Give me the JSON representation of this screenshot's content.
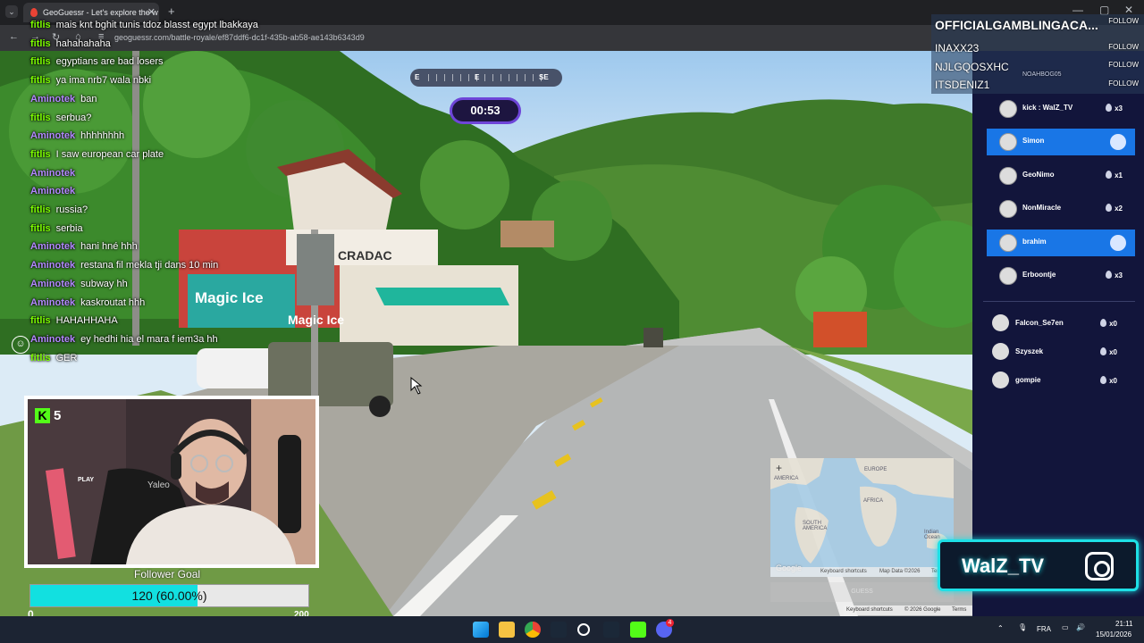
{
  "browser": {
    "tab_title": "GeoGuessr - Let's explore the w",
    "url": "geoguessr.com/battle-royale/ef87ddf6-dc1f-435b-ab58-ae143b6343d9",
    "new_tab": "+",
    "close_tab": "✕"
  },
  "chat": {
    "messages": [
      {
        "user": "fitlis",
        "text": "mais knt bghit tunis tdoz blasst egypt lbakkaya",
        "color": "#7CFC00"
      },
      {
        "user": "fitlis",
        "text": "hahahahaha",
        "color": "#7CFC00"
      },
      {
        "user": "fitlis",
        "text": "egyptians are bad losers",
        "color": "#7CFC00"
      },
      {
        "user": "fitlis",
        "text": "ya ima nrb7 wala nbki",
        "color": "#7CFC00"
      },
      {
        "user": "Aminotek",
        "text": "ban",
        "color": "#b388ff"
      },
      {
        "user": "fitlis",
        "text": "serbua?",
        "color": "#7CFC00"
      },
      {
        "user": "Aminotek",
        "text": "hhhhhhhh",
        "color": "#b388ff"
      },
      {
        "user": "fitlis",
        "text": "I saw european car plate",
        "color": "#7CFC00"
      },
      {
        "user": "Aminotek",
        "text": "",
        "color": "#b388ff"
      },
      {
        "user": "Aminotek",
        "text": "",
        "color": "#b388ff"
      },
      {
        "user": "fitlis",
        "text": "russia?",
        "color": "#7CFC00"
      },
      {
        "user": "fitlis",
        "text": "serbia",
        "color": "#7CFC00"
      },
      {
        "user": "Aminotek",
        "text": "hani hné hhh",
        "color": "#b388ff"
      },
      {
        "user": "Aminotek",
        "text": "restana fil mekla tji dans 10 min",
        "color": "#b388ff"
      },
      {
        "user": "Aminotek",
        "text": "subway hh",
        "color": "#b388ff"
      },
      {
        "user": "Aminotek",
        "text": "kaskroutat hhh",
        "color": "#b388ff"
      },
      {
        "user": "fitlis",
        "text": "HAHAHHAHA",
        "color": "#7CFC00"
      },
      {
        "user": "Aminotek",
        "text": "ey hedhi hia el mara f iem3a hh",
        "color": "#b388ff"
      },
      {
        "user": "fitlis",
        "text": "GER",
        "color": "#7CFC00"
      }
    ]
  },
  "compass": {
    "left": "E",
    "center": "E",
    "right": "SE"
  },
  "timer": "00:53",
  "webcam": {
    "kick_count": "5",
    "kick_letter": "K",
    "chair_text": "Yaleo",
    "sign_text": "PLAY"
  },
  "scene": {
    "shop_sign": "Magic Ice",
    "shop_sign_2": "Magic Ice",
    "store_name": "CRADAC"
  },
  "follower_goal": {
    "title": "Follower Goal",
    "text": "120 (60.00%)",
    "progress": 0.6,
    "min": "0",
    "max": "200"
  },
  "recent_followers": {
    "top": "OFFICIALGAMBLINGACA...",
    "items": [
      "INAXX23",
      "NJLGQOSXHC",
      "ITSDENIZ1"
    ],
    "follow_label": "FOLLOW",
    "faded": "NOAHBOG05"
  },
  "battle_royale": {
    "players": [
      {
        "name": "kick : WalZ_TV",
        "score": "x3",
        "highlight": false
      },
      {
        "name": "Simon",
        "score": "",
        "highlight": true
      },
      {
        "name": "GeoNimo",
        "score": "x1",
        "highlight": false
      },
      {
        "name": "NonMiracle",
        "score": "x2",
        "highlight": false
      },
      {
        "name": "brahim",
        "score": "",
        "highlight": true
      },
      {
        "name": "Erboontje",
        "score": "x3",
        "highlight": false
      }
    ],
    "eliminated": [
      {
        "name": "Falcon_Se7en",
        "score": "x0"
      },
      {
        "name": "Szyszek",
        "score": "x0"
      },
      {
        "name": "gompie",
        "score": "x0"
      }
    ]
  },
  "minimap": {
    "labels": {
      "europe": "EUROPE",
      "africa": "AFRICA",
      "south_america": "SOUTH AMERICA",
      "america": "AMERICA",
      "indian_ocean": "Indian Ocean"
    },
    "google": "Google",
    "shortcuts": "Keyboard shortcuts",
    "map_data": "Map Data ©2026",
    "terms": "Ter",
    "guess": "GUESS",
    "zoom": "+"
  },
  "streetview_footer": {
    "shortcuts": "Keyboard shortcuts",
    "copyright": "© 2026 Google",
    "terms": "Terms"
  },
  "brand": {
    "name": "WalZ_TV"
  },
  "taskbar": {
    "lang": "FRA",
    "time": "21:11",
    "date": "15/01/2026",
    "discord_badge": "4"
  }
}
